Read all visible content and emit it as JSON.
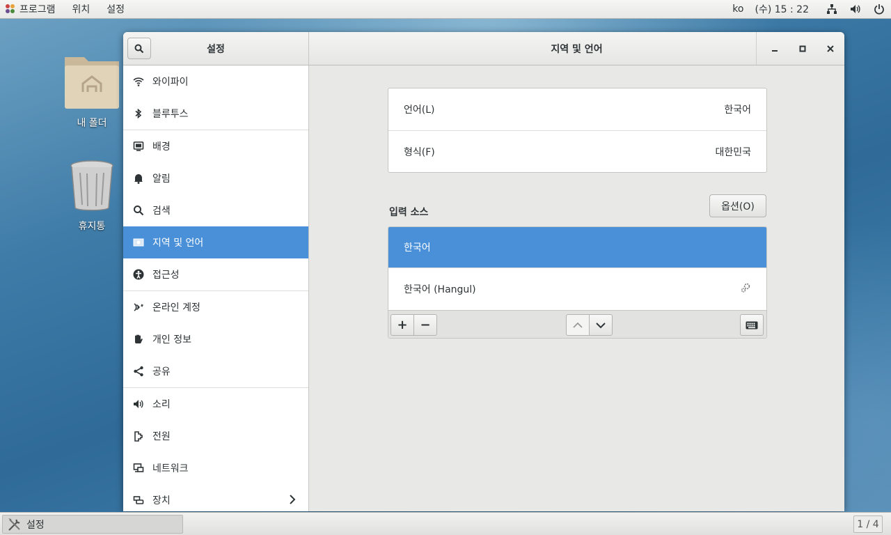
{
  "topbar": {
    "menus": [
      "프로그램",
      "위치",
      "설정"
    ],
    "lang": "ko",
    "clock": "(수) 15 : 22",
    "icons": [
      "network-icon",
      "volume-icon",
      "power-icon"
    ]
  },
  "desktop": {
    "home_label": "내 폴더",
    "trash_label": "휴지통"
  },
  "window": {
    "sidebar_title": "설정",
    "page_title": "지역 및 언어"
  },
  "sidebar": {
    "items": [
      {
        "label": "와이파이",
        "icon": "wifi-icon"
      },
      {
        "label": "블루투스",
        "icon": "bluetooth-icon"
      },
      {
        "label": "배경",
        "icon": "background-icon"
      },
      {
        "label": "알림",
        "icon": "bell-icon"
      },
      {
        "label": "검색",
        "icon": "search-icon"
      },
      {
        "label": "지역 및 언어",
        "icon": "flag-icon"
      },
      {
        "label": "접근성",
        "icon": "accessibility-icon"
      },
      {
        "label": "온라인 계정",
        "icon": "online-accounts-icon"
      },
      {
        "label": "개인 정보",
        "icon": "privacy-hand-icon"
      },
      {
        "label": "공유",
        "icon": "share-icon"
      },
      {
        "label": "소리",
        "icon": "speaker-icon"
      },
      {
        "label": "전원",
        "icon": "power-plug-icon"
      },
      {
        "label": "네트워크",
        "icon": "network-icon"
      },
      {
        "label": "장치",
        "icon": "devices-icon"
      }
    ],
    "active": "지역 및 언어"
  },
  "region": {
    "language_label": "언어(L)",
    "language_value": "한국어",
    "formats_label": "형식(F)",
    "formats_value": "대한민국"
  },
  "input_sources": {
    "title": "입력 소스",
    "options_label": "옵션(O)",
    "items": [
      "한국어",
      "한국어 (Hangul)"
    ],
    "selected": "한국어",
    "add_label": "+",
    "remove_label": "−"
  },
  "taskbar": {
    "task_label": "설정",
    "workspace": "1 / 4"
  },
  "colors": {
    "accent": "#4a90d9",
    "window_bg": "#e8e8e7"
  }
}
